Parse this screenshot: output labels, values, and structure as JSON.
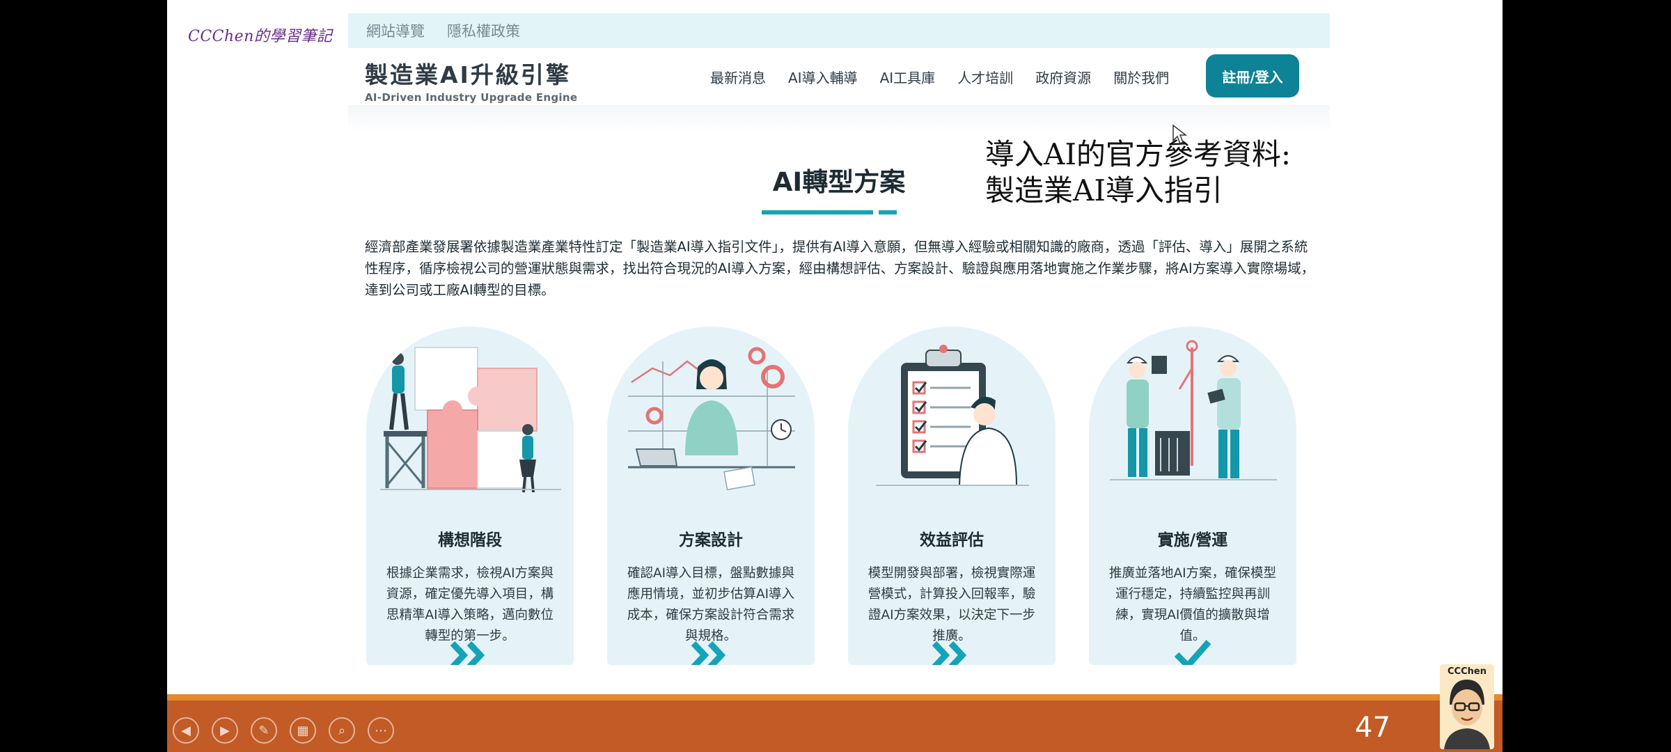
{
  "brand": "CCChen的學習筆記",
  "site": {
    "utility_links": [
      "網站導覽",
      "隱私權政策"
    ],
    "logo_title": "製造業AI升級引擎",
    "logo_subtitle": "AI-Driven Industry Upgrade Engine",
    "nav": [
      "最新消息",
      "AI導入輔導",
      "AI工具庫",
      "人才培訓",
      "政府資源",
      "關於我們"
    ],
    "signin_label": "註冊/登入",
    "section_title": "AI轉型方案",
    "intro": "經濟部產業發展署依據製造業產業特性訂定「製造業AI導入指引文件」，提供有AI導入意願，但無導入經驗或相關知識的廠商，透過「評估、導入」展開之系統性程序，循序檢視公司的營運狀態與需求，找出符合現況的AI導入方案，經由構想評估、方案設計、驗證與應用落地實施之作業步驟，將AI方案導入實際場域，達到公司或工廠AI轉型的目標。",
    "cards": [
      {
        "title": "構想階段",
        "desc": "根據企業需求，檢視AI方案與資源，確定優先導入項目，構思精準AI導入策略，邁向數位轉型的第一步。",
        "icon": "puzzle-illustration",
        "footer_icon": "double-chevron-icon"
      },
      {
        "title": "方案設計",
        "desc": "確認AI導入目標，盤點數據與應用情境，並初步估算AI導入成本，確保方案設計符合需求與規格。",
        "icon": "planning-illustration",
        "footer_icon": "double-chevron-icon"
      },
      {
        "title": "效益評估",
        "desc": "模型開發與部署，檢視實際運營模式，計算投入回報率，驗證AI方案效果，以決定下一步推廣。",
        "icon": "checklist-illustration",
        "footer_icon": "double-chevron-icon"
      },
      {
        "title": "實施/營運",
        "desc": "推廣並落地AI方案，確保模型運行穩定，持續監控與再訓練，實現AI價值的擴散與增值。",
        "icon": "engineers-illustration",
        "footer_icon": "checkmark-icon"
      }
    ]
  },
  "note": {
    "line1": "導入AI的官方參考資料:",
    "line2": "製造業AI導入指引"
  },
  "slideshow": {
    "page_number": "47",
    "presenter_name": "CCChen",
    "controls": [
      "previous-icon",
      "next-icon",
      "pen-icon",
      "slides-icon",
      "zoom-icon",
      "more-icon"
    ]
  },
  "colors": {
    "accent": "#0e8297",
    "teal_bar": "#12a5b8",
    "card_bg": "#e5f3f9",
    "bottom_bar": "#c25b26",
    "bottom_border": "#e3892e",
    "brand": "#6a2c8a"
  }
}
